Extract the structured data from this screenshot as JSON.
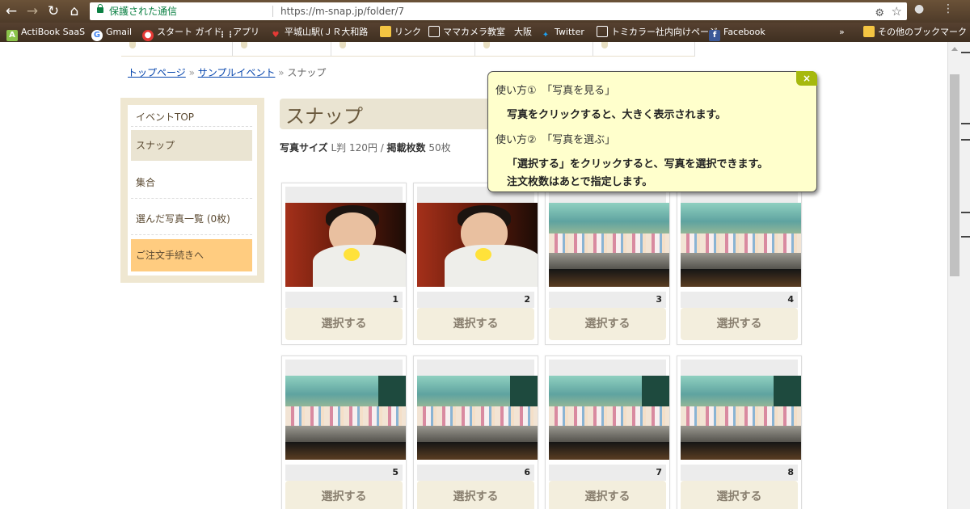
{
  "browser": {
    "secure_text": "保護された通信",
    "url": "https://m-snap.jp/folder/7",
    "more_bookmarks_text": "»",
    "other_bookmarks": "その他のブックマーク",
    "bookmarks": [
      {
        "label": "ActiBook SaaS",
        "icon": "actibook-icon"
      },
      {
        "label": "Gmail",
        "icon": "google-icon"
      },
      {
        "label": "スタート ガイド",
        "icon": "chrome-icon"
      },
      {
        "label": "アプリ",
        "icon": "apps-grid-icon"
      },
      {
        "label": "平城山駅(ＪＲ大和路",
        "icon": "heart-icon"
      },
      {
        "label": "リンク",
        "icon": "folder-icon"
      },
      {
        "label": "ママカメラ教室　大阪",
        "icon": "page-icon"
      },
      {
        "label": "Twitter",
        "icon": "twitter-icon"
      },
      {
        "label": "トミカラー社内向けページ",
        "icon": "page-icon"
      },
      {
        "label": "Facebook",
        "icon": "facebook-icon"
      }
    ]
  },
  "breadcrumb": {
    "home": "トップページ",
    "event": "サンプルイベント",
    "current": "スナップ",
    "separator": "»"
  },
  "sidebar": {
    "event_top": "イベントTOP",
    "snap": "スナップ",
    "group": "集合",
    "chosen": "選んだ写真一覧 (0枚)",
    "order": "ご注文手続きへ"
  },
  "main": {
    "title": "スナップ",
    "size_label": "写真サイズ",
    "size_value": "L判 120円",
    "slash": " / ",
    "count_label": "掲載枚数",
    "count_value": "50枚"
  },
  "photos": [
    {
      "number": "1",
      "select_label": "選択する",
      "scene": "baby"
    },
    {
      "number": "2",
      "select_label": "選択する",
      "scene": "baby"
    },
    {
      "number": "3",
      "select_label": "選択する",
      "scene": "stage"
    },
    {
      "number": "4",
      "select_label": "選択する",
      "scene": "stage"
    },
    {
      "number": "5",
      "select_label": "選択する",
      "scene": "stage"
    },
    {
      "number": "6",
      "select_label": "選択する",
      "scene": "stage"
    },
    {
      "number": "7",
      "select_label": "選択する",
      "scene": "stage"
    },
    {
      "number": "8",
      "select_label": "選択する",
      "scene": "stage"
    }
  ],
  "tooltip": {
    "close": "×",
    "step1_heading": "使い方①　「写真を見る」",
    "step1_body": "写真をクリックすると、大きく表示されます。",
    "step2_heading": "使い方②　「写真を選ぶ」",
    "step2_body_1": "「選択する」をクリックすると、写真を選択できます。",
    "step2_body_2": "注文枚数はあとで指定します。"
  },
  "colors": {
    "accent_sidebar": "#efe7d1",
    "order_button": "#ffcc80",
    "tooltip_bg": "#ffffcc",
    "tooltip_close": "#a6b90e"
  }
}
